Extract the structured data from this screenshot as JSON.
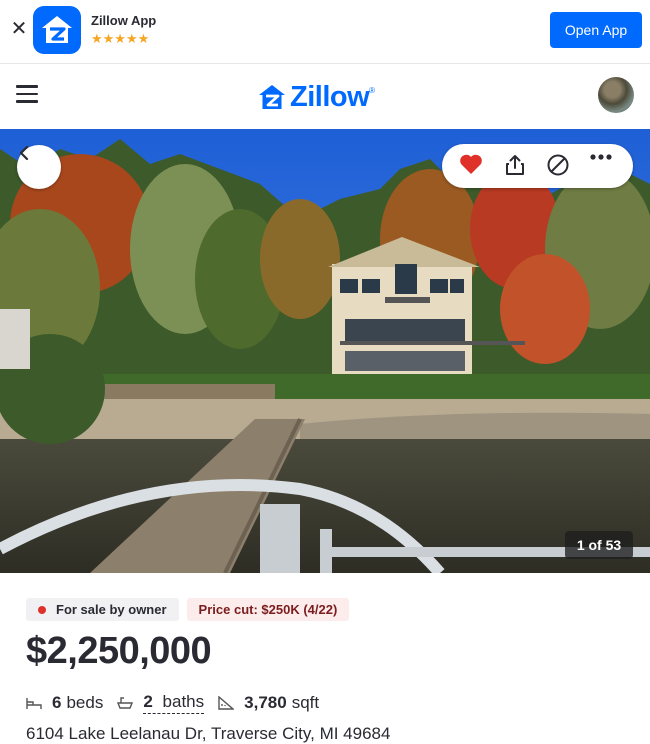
{
  "banner": {
    "close_icon": "close-icon",
    "app_name": "Zillow App",
    "stars": "★★★★★",
    "open_button": "Open App"
  },
  "header": {
    "menu_icon": "hamburger-icon",
    "logo_text": "Zillow",
    "logo_mark": "®"
  },
  "gallery": {
    "counter": "1 of 53",
    "saved": true,
    "icons": [
      "chevron-left-icon",
      "heart-icon",
      "share-icon",
      "hide-icon",
      "more-icon"
    ]
  },
  "listing": {
    "status": "For sale by owner",
    "price_cut": "Price cut: $250K (4/22)",
    "price": "$2,250,000",
    "beds_value": "6",
    "beds_label": "beds",
    "baths_value": "2",
    "baths_label": "baths",
    "sqft_value": "3,780",
    "sqft_label": "sqft",
    "address": "6104 Lake Leelanau Dr, Traverse City, MI 49684"
  },
  "colors": {
    "brand": "#006aff",
    "heart": "#e0302a",
    "status_dot": "#e0302a"
  }
}
